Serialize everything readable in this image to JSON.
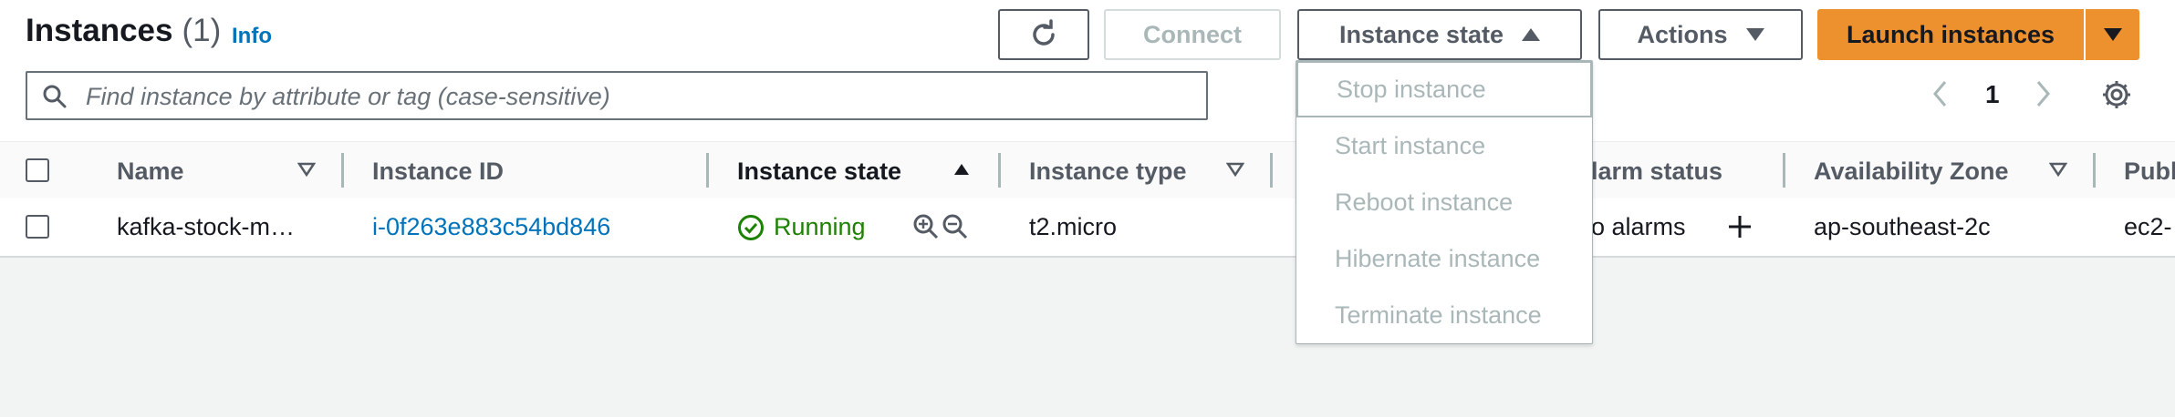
{
  "header": {
    "title": "Instances",
    "count": "(1)",
    "info": "Info"
  },
  "toolbar": {
    "refresh_icon": "refresh-icon",
    "connect": "Connect",
    "instance_state": "Instance state",
    "actions": "Actions",
    "launch": "Launch instances"
  },
  "search": {
    "placeholder": "Find instance by attribute or tag (case-sensitive)"
  },
  "pagination": {
    "page": "1"
  },
  "table": {
    "columns": {
      "name": "Name",
      "instance_id": "Instance ID",
      "instance_state": "Instance state",
      "instance_type": "Instance type",
      "alarm_status": "larm status",
      "availability_zone": "Availability Zone",
      "public": "Publ"
    },
    "row": {
      "name": "kafka-stock-m…",
      "instance_id": "i-0f263e883c54bd846",
      "state": "Running",
      "type": "t2.micro",
      "alarm": "o alarms",
      "zone": "ap-southeast-2c",
      "public": "ec2-"
    }
  },
  "state_menu": {
    "items": [
      "Stop instance",
      "Start instance",
      "Reboot instance",
      "Hibernate instance",
      "Terminate instance"
    ]
  },
  "colors": {
    "accent": "#ec912e",
    "link": "#0073bb",
    "running": "#1d8102",
    "disabled": "#aab7b8"
  }
}
